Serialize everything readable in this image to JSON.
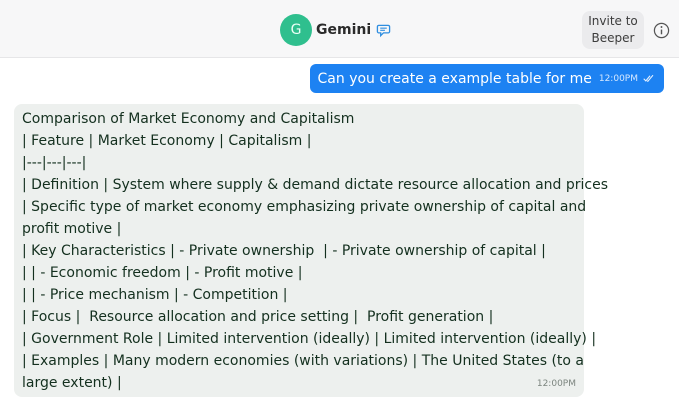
{
  "header": {
    "avatar_letter": "G",
    "chat_name": "Gemini",
    "invite_label": "Invite to\nBeeper",
    "icons": [
      "chat-bubble-icon",
      "info-icon"
    ]
  },
  "colors": {
    "avatar_bg": "#2fbf8e",
    "outgoing_bubble": "#1d82f2",
    "incoming_bubble": "#edf0ee"
  },
  "outgoing_message": {
    "text": "Can you create a example table for me",
    "time": "12:00PM"
  },
  "incoming_message": {
    "lines": [
      "Comparison of Market Economy and Capitalism",
      "| Feature | Market Economy | Capitalism |",
      "|---|---|---|",
      "| Definition | System where supply & demand dictate resource allocation and prices",
      "| Specific type of market economy emphasizing private ownership of capital and",
      "profit motive |",
      "| Key Characteristics | - Private ownership  | - Private ownership of capital |",
      "| | - Economic freedom | - Profit motive |",
      "| | - Price mechanism | - Competition |",
      "| Focus |  Resource allocation and price setting |  Profit generation |",
      "| Government Role | Limited intervention (ideally) | Limited intervention (ideally) |",
      "| Examples | Many modern economies (with variations) | The United States (to a",
      "large extent) |"
    ],
    "time": "12:00PM"
  }
}
